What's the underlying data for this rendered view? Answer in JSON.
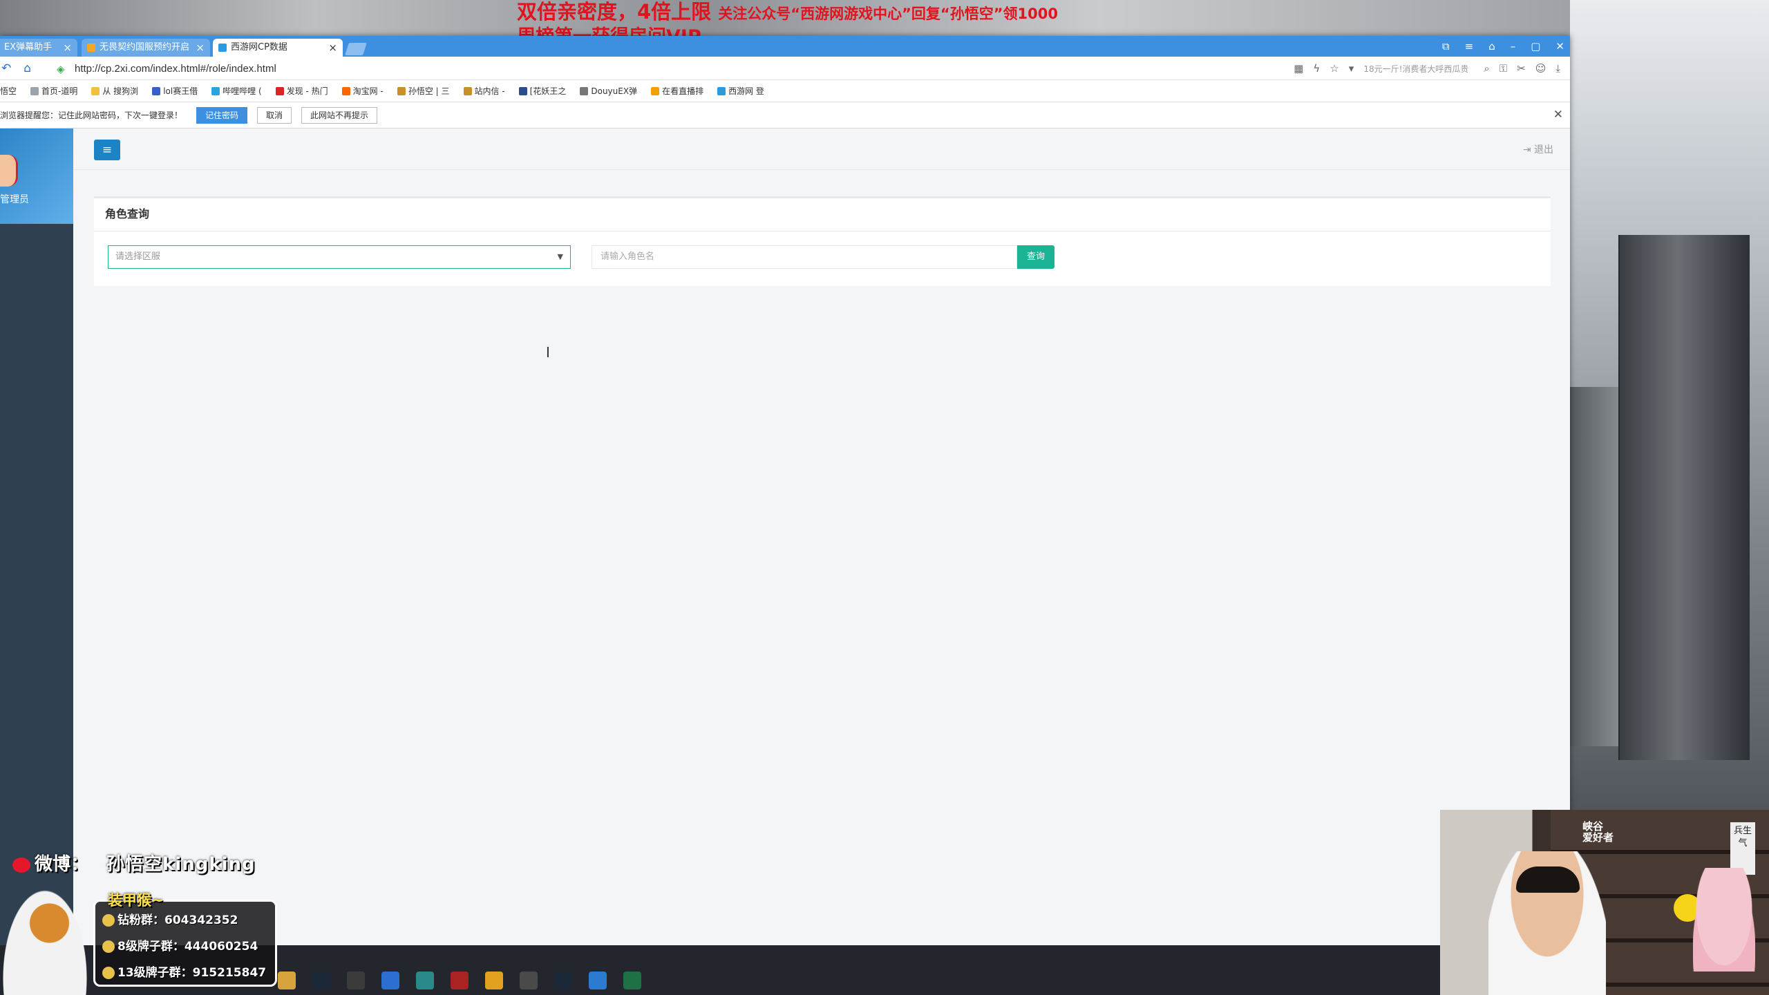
{
  "promo": {
    "line1_big": "双倍亲密度，4倍上限",
    "line1_small": "关注公众号“西游网游戏中心”回复“孙悟空”领1000",
    "line2": "周榜第一获得房间VIP"
  },
  "browser": {
    "tabs": [
      {
        "label": "EX弹幕助手"
      },
      {
        "label": "无畏契约国服预约开启"
      },
      {
        "label": "西游网CP数据"
      }
    ],
    "window_controls": [
      "⧉",
      "≡",
      "⌂",
      "–",
      "▢",
      "✕"
    ],
    "url": "http://cp.2xi.com/index.html#/role/index.html",
    "search_hint": "18元一斤!消费者大呼西瓜贵",
    "bookmarks": [
      "悟空",
      "首页-道明",
      "从 搜狗浏",
      "lol赛王借",
      "哔哩哔哩 (",
      "发现 - 热门",
      "淘宝网 -",
      "孙悟空 | 三",
      "站内信 -",
      "[花妖王之",
      "DouyuEX弹",
      "在看直播排",
      "西游网 登"
    ],
    "password_bar": {
      "message": "浏览器提醒您：记住此网站密码，下次一键登录！",
      "remember": "记住密码",
      "cancel": "取消",
      "never": "此网站不再提示"
    }
  },
  "page": {
    "sidebar_role_label": "管理员",
    "menu_icon": "≡",
    "logout": "退出",
    "panel_title": "角色查询",
    "server_placeholder": "请选择区服",
    "role_placeholder": "请输入角色名",
    "query_button": "查询"
  },
  "overlay": {
    "weibo_label": "微博：",
    "weibo_name": "孙悟空kingking",
    "group_title": "装甲猴~",
    "fan_group": "钻粉群：604342352",
    "group_8": "8级牌子群：444060254",
    "group_13": "13级牌子群：915215847",
    "cam_sign_1": "峡谷",
    "cam_sign_2": "爱好者",
    "cam_plate": "兵生气"
  },
  "colors": {
    "tab_bar": "#3d8fdf",
    "primary_green": "#1ab394",
    "menu_blue": "#1c84c6",
    "promo_red": "#e0141e"
  }
}
